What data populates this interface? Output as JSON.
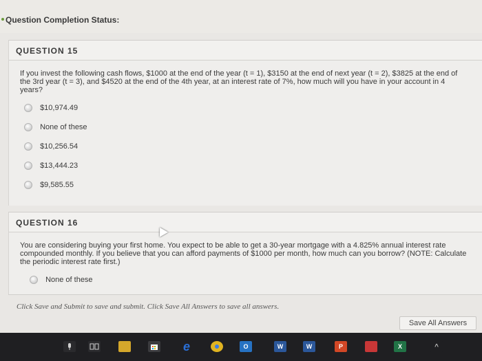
{
  "status": {
    "title": "Question Completion Status:"
  },
  "q15": {
    "title": "QUESTION 15",
    "text": "If you invest the following cash flows, $1000 at the end of the year (t = 1), $3150 at the end of next year (t = 2), $3825 at the end of the 3rd year (t = 3), and $4520 at the end of the 4th year, at an interest rate of 7%, how much will you have in your account in 4 years?",
    "options": [
      "$10,974.49",
      "None of these",
      "$10,256.54",
      "$13,444.23",
      "$9,585.55"
    ]
  },
  "q16": {
    "title": "QUESTION 16",
    "text": "You are considering buying your first home. You expect to be able to get a 30-year mortgage with a 4.825% annual interest rate compounded monthly. If you believe that you can afford payments of $1000 per month, how much can you borrow? (NOTE: Calculate the periodic interest rate first.)",
    "options": [
      "None of these"
    ]
  },
  "footer": {
    "note": "Click Save and Submit to save and submit. Click Save All Answers to save all answers.",
    "save_all_label": "Save All Answers"
  },
  "taskbar": {
    "icons": [
      "microphone-icon",
      "task-view-icon",
      "file-explorer-icon",
      "store-icon",
      "edge-icon",
      "chrome-icon",
      "outlook-icon",
      "word-icon",
      "word-icon-2",
      "powerpoint-icon",
      "app-icon",
      "excel-icon"
    ],
    "colors": {
      "edge": "#2a6fd6",
      "chrome": "#e0b321",
      "outlook": "#2672c3",
      "word": "#2b579a",
      "powerpoint": "#d24726",
      "excel": "#217346"
    },
    "edge_glyph": "e",
    "outlook_glyph": "O",
    "word_glyph": "W",
    "powerpoint_glyph": "P",
    "excel_glyph": "X"
  }
}
